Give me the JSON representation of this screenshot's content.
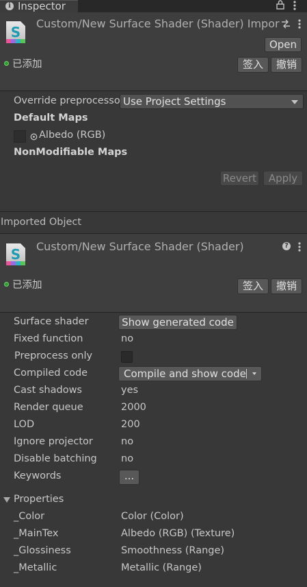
{
  "tab": {
    "label": "Inspector",
    "icon": "info-icon"
  },
  "asset_header": {
    "title": "Custom/New Surface Shader (Shader) Impor",
    "open_label": "Open",
    "status_label": "已添加",
    "checkin_label": "签入",
    "revert_label": "撤销"
  },
  "import_settings": {
    "override_label": "Override preprocesso",
    "override_value": "Use Project Settings",
    "default_maps_label": "Default Maps",
    "albedo_label": "Albedo (RGB)",
    "nonmodifiable_label": "NonModifiable Maps",
    "revert_button": "Revert",
    "apply_button": "Apply"
  },
  "imported_object": {
    "section_label": "Imported Object",
    "title": "Custom/New Surface Shader (Shader)",
    "status_label": "已添加",
    "checkin_label": "签入",
    "revert_label": "撤销"
  },
  "shader_info": {
    "surface_shader_label": "Surface shader",
    "show_generated_label": "Show generated code",
    "fixed_function_label": "Fixed function",
    "fixed_function_value": "no",
    "preprocess_only_label": "Preprocess only",
    "compiled_code_label": "Compiled code",
    "compile_show_label": "Compile and show code",
    "cast_shadows_label": "Cast shadows",
    "cast_shadows_value": "yes",
    "render_queue_label": "Render queue",
    "render_queue_value": "2000",
    "lod_label": "LOD",
    "lod_value": "200",
    "ignore_projector_label": "Ignore projector",
    "ignore_projector_value": "no",
    "disable_batching_label": "Disable batching",
    "disable_batching_value": "no",
    "keywords_label": "Keywords",
    "keywords_button": "..."
  },
  "properties": {
    "header": "Properties",
    "rows": [
      {
        "name": "_Color",
        "value": "Color (Color)"
      },
      {
        "name": "_MainTex",
        "value": "Albedo (RGB) (Texture)"
      },
      {
        "name": "_Glossiness",
        "value": "Smoothness (Range)"
      },
      {
        "name": "_Metallic",
        "value": "Metallic (Range)"
      }
    ]
  }
}
